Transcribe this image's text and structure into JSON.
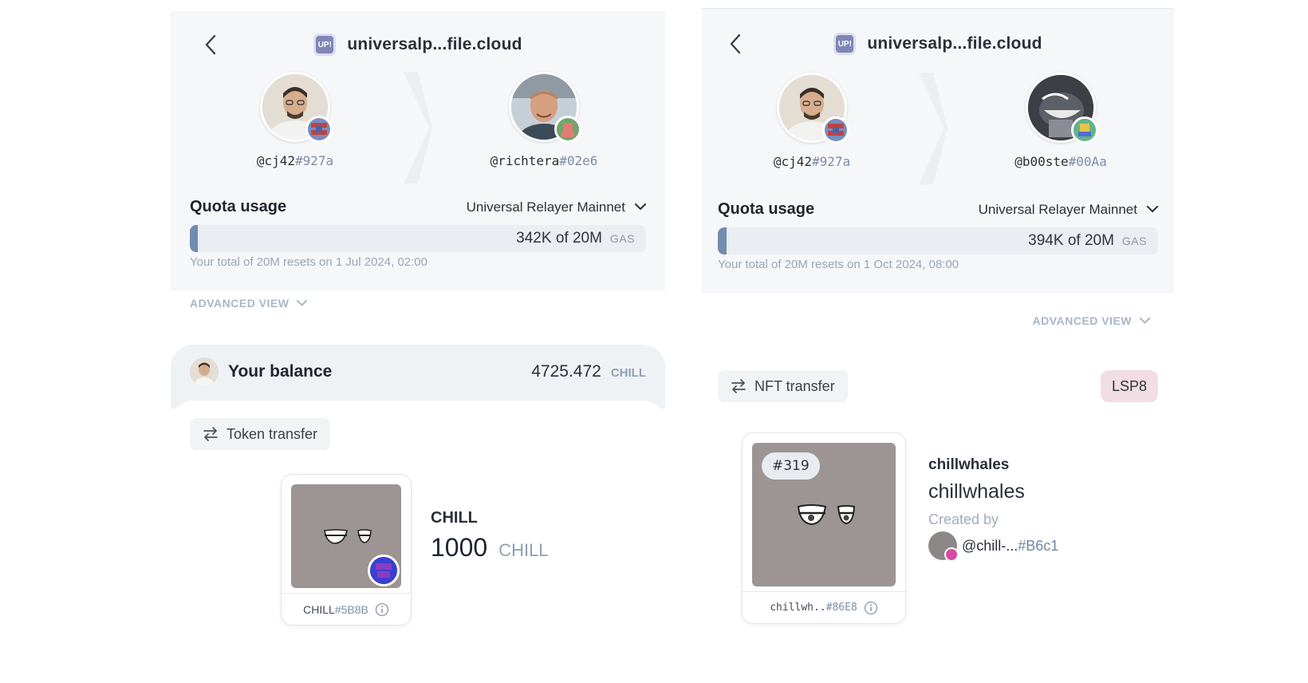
{
  "left": {
    "site": {
      "logo_text": "UP!",
      "name": "universalp...file.cloud"
    },
    "sender": {
      "handle": "@cj42",
      "hash": "#927a"
    },
    "receiver": {
      "handle": "@richtera",
      "hash": "#02e6"
    },
    "quota": {
      "title": "Quota usage",
      "relayer": "Universal Relayer Mainnet",
      "used_fraction": 0.017,
      "amount": "342K of 20M",
      "unit": "GAS",
      "resets": "Your total of 20M resets on 1 Jul 2024, 02:00"
    },
    "advanced_view": "ADVANCED VIEW",
    "balance": {
      "label": "Your balance",
      "amount": "4725.472",
      "unit": "CHILL"
    },
    "transfer_chip": "Token transfer",
    "asset": {
      "symbol_label": "CHILL",
      "hash": "#5B8B",
      "name": "CHILL",
      "amount": "1000",
      "unit": "CHILL"
    }
  },
  "right": {
    "site": {
      "logo_text": "UP!",
      "name": "universalp...file.cloud"
    },
    "sender": {
      "handle": "@cj42",
      "hash": "#927a"
    },
    "receiver": {
      "handle": "@b00ste",
      "hash": "#00Aa"
    },
    "quota": {
      "title": "Quota usage",
      "relayer": "Universal Relayer Mainnet",
      "used_fraction": 0.0197,
      "amount": "394K of 20M",
      "unit": "GAS",
      "resets": "Your total of 20M resets on 1 Oct 2024, 08:00"
    },
    "advanced_view": "ADVANCED VIEW",
    "transfer_chip": "NFT transfer",
    "standard_badge": "LSP8",
    "nft": {
      "number": "#319",
      "footer_name": "chillwh..",
      "footer_hash": "#86E8",
      "collection": "chillwhales",
      "title": "chillwhales",
      "created_by_label": "Created by",
      "creator_handle": "@chill-...",
      "creator_hash": "#B6c1"
    }
  },
  "colors": {
    "accent": "#6f8eae",
    "muted": "#8ea0b5",
    "lsp8_bg": "#f1dde2"
  }
}
